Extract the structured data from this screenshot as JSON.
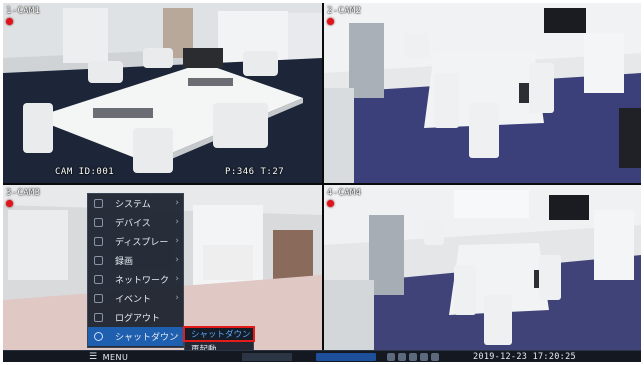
{
  "cameras": [
    {
      "label": "1-CAM1",
      "recording": true
    },
    {
      "label": "2-CAM2",
      "recording": true
    },
    {
      "label": "3-CAM3",
      "recording": true
    },
    {
      "label": "4-CAM4",
      "recording": true
    }
  ],
  "osd": {
    "cam_id": "CAM ID:001",
    "pt": "P:346 T:27"
  },
  "menu": {
    "items": [
      {
        "label": "システム",
        "icon": "system-icon"
      },
      {
        "label": "デバイス",
        "icon": "device-icon"
      },
      {
        "label": "ディスプレー",
        "icon": "display-icon"
      },
      {
        "label": "録画",
        "icon": "record-icon"
      },
      {
        "label": "ネットワーク",
        "icon": "network-icon"
      },
      {
        "label": "イベント",
        "icon": "event-icon"
      },
      {
        "label": "ログアウト",
        "icon": "logout-icon"
      },
      {
        "label": "シャットダウン",
        "icon": "power-icon",
        "active": true
      }
    ],
    "submenu": [
      {
        "label": "シャットダウン",
        "selected": true
      },
      {
        "label": "再起動"
      }
    ]
  },
  "taskbar": {
    "menu_label": "MENU",
    "datetime": "2019-12-23 17:20:25"
  },
  "colors": {
    "accent": "#1f5fb0",
    "highlight": "#e31b1b",
    "rec": "#e0121a"
  }
}
